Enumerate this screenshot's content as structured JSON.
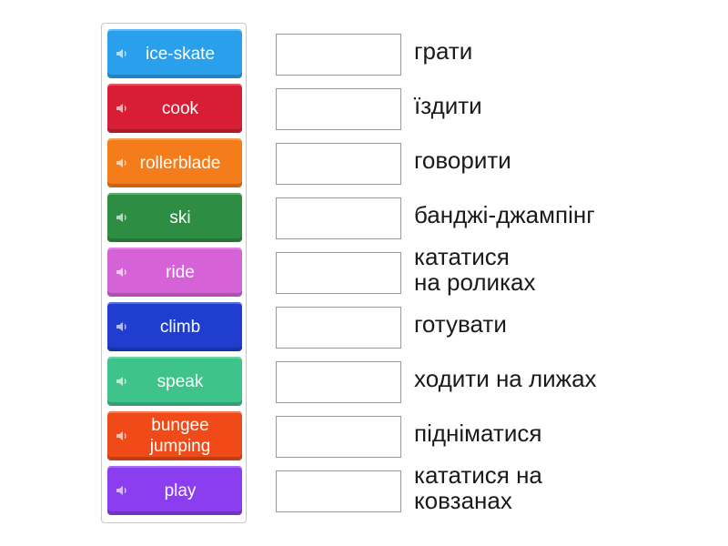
{
  "tiles": [
    {
      "label": "ice-skate",
      "color": "#2aa0ec"
    },
    {
      "label": "cook",
      "color": "#d81e35"
    },
    {
      "label": "rollerblade",
      "color": "#f47c1a"
    },
    {
      "label": "ski",
      "color": "#2d8e43"
    },
    {
      "label": "ride",
      "color": "#d562d6"
    },
    {
      "label": "climb",
      "color": "#1f3ed0"
    },
    {
      "label": "speak",
      "color": "#3ec48b"
    },
    {
      "label": "bungee\njumping",
      "color": "#ef4a17"
    },
    {
      "label": "play",
      "color": "#8a3ef0"
    }
  ],
  "targets": [
    "грати",
    "їздити",
    "говорити",
    "банджі-джампінг",
    "кататися\nна роликах",
    "готувати",
    "ходити на лижах",
    "підніматися",
    "кататися на\nковзанах"
  ]
}
